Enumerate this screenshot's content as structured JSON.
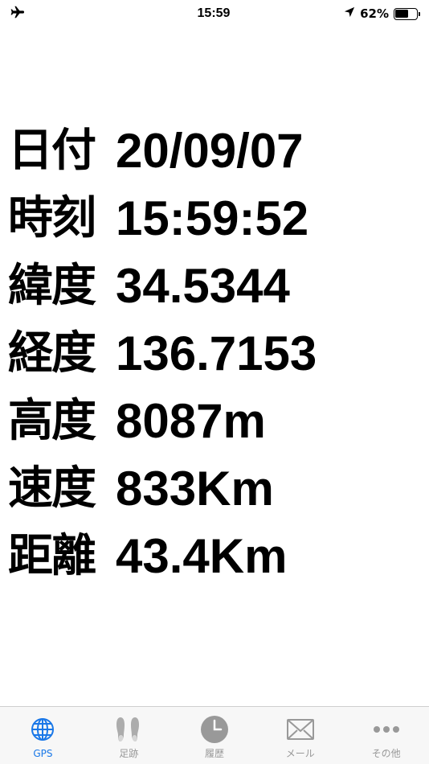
{
  "status_bar": {
    "time": "15:59",
    "battery_percent": "62%",
    "battery_level": 0.62
  },
  "readout": [
    {
      "label": "日付",
      "value": "20/09/07"
    },
    {
      "label": "時刻",
      "value": "15:59:52"
    },
    {
      "label": "緯度",
      "value": "34.5344"
    },
    {
      "label": "経度",
      "value": "136.7153"
    },
    {
      "label": "高度",
      "value": "8087m"
    },
    {
      "label": "速度",
      "value": "833Km"
    },
    {
      "label": "距離",
      "value": "43.4Km"
    }
  ],
  "tab_bar": {
    "tabs": [
      {
        "label": "GPS",
        "icon": "globe-icon",
        "active": true
      },
      {
        "label": "足跡",
        "icon": "footprints-icon",
        "active": false
      },
      {
        "label": "履歴",
        "icon": "clock-icon",
        "active": false
      },
      {
        "label": "メール",
        "icon": "envelope-icon",
        "active": false
      },
      {
        "label": "その他",
        "icon": "more-icon",
        "active": false
      }
    ]
  },
  "colors": {
    "accent": "#1a78e8",
    "inactive": "#999999",
    "tab_bar_bg": "#f7f7f7"
  }
}
